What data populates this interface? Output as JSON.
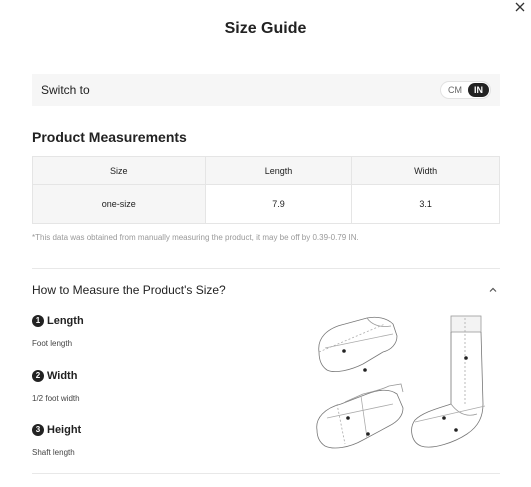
{
  "title": "Size Guide",
  "switch": {
    "label": "Switch to",
    "options": [
      "CM",
      "IN"
    ],
    "selected": "IN"
  },
  "product_measurements": {
    "title": "Product Measurements",
    "headers": [
      "Size",
      "Length",
      "Width"
    ],
    "rows": [
      {
        "size": "one-size",
        "length": "7.9",
        "width": "3.1"
      }
    ],
    "note": "*This data was obtained from manually measuring the product, it may be off by 0.39-0.79 IN."
  },
  "how_to_measure": {
    "title": "How to Measure the Product's Size?",
    "steps": [
      {
        "num": "1",
        "name": "Length",
        "desc": "Foot length"
      },
      {
        "num": "2",
        "name": "Width",
        "desc": "1/2 foot width"
      },
      {
        "num": "3",
        "name": "Height",
        "desc": "Shaft length"
      }
    ]
  },
  "icons": {
    "close": "close-icon",
    "collapse": "chevron-up-icon"
  },
  "colors": {
    "active_toggle": "#222222",
    "panel_bg": "#f6f6f6",
    "border": "#e5e5e5",
    "note": "#999999"
  }
}
